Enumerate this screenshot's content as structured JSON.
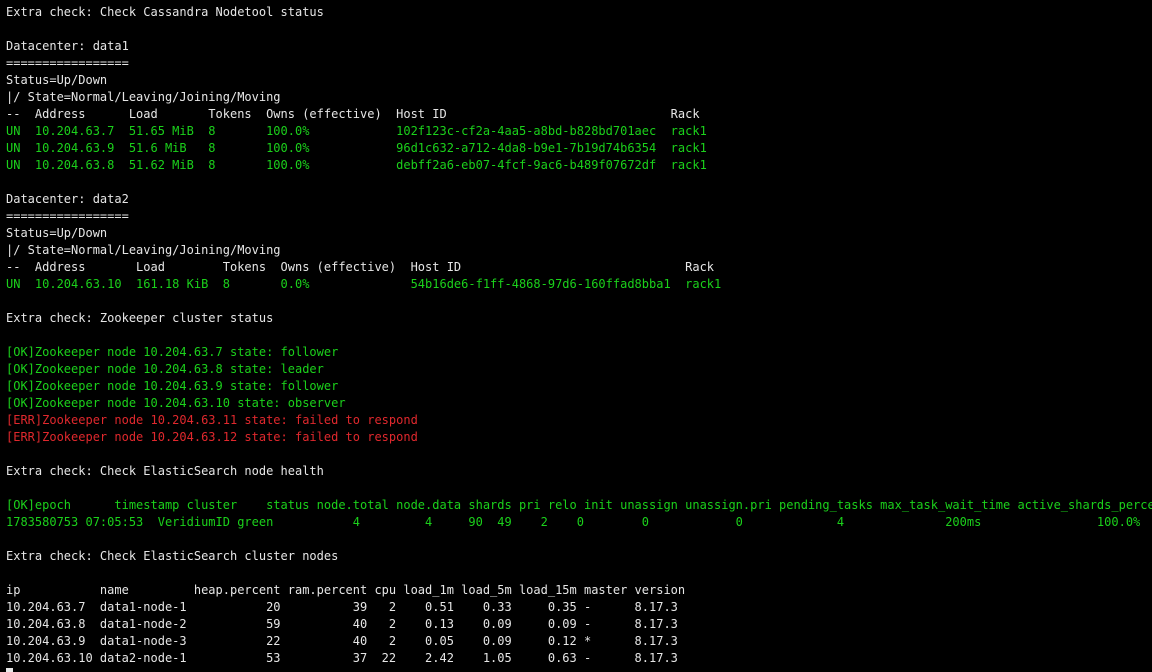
{
  "colors": {
    "background": "#000000",
    "text": "#e6e6e6",
    "ok_green": "#1bd11b",
    "error_red": "#e0282d"
  },
  "lines": [
    {
      "text": "Extra check: Check Cassandra Nodetool status",
      "color": "white"
    },
    {
      "text": "",
      "color": "white"
    },
    {
      "text": "Datacenter: data1",
      "color": "white"
    },
    {
      "text": "=================",
      "color": "white"
    },
    {
      "text": "Status=Up/Down",
      "color": "white"
    },
    {
      "text": "|/ State=Normal/Leaving/Joining/Moving",
      "color": "white"
    },
    {
      "text": "--  Address      Load       Tokens  Owns (effective)  Host ID                               Rack",
      "color": "white"
    },
    {
      "text": "UN  10.204.63.7  51.65 MiB  8       100.0%            102f123c-cf2a-4aa5-a8bd-b828bd701aec  rack1",
      "color": "green"
    },
    {
      "text": "UN  10.204.63.9  51.6 MiB   8       100.0%            96d1c632-a712-4da8-b9e1-7b19d74b6354  rack1",
      "color": "green"
    },
    {
      "text": "UN  10.204.63.8  51.62 MiB  8       100.0%            debff2a6-eb07-4fcf-9ac6-b489f07672df  rack1",
      "color": "green"
    },
    {
      "text": "",
      "color": "white"
    },
    {
      "text": "Datacenter: data2",
      "color": "white"
    },
    {
      "text": "=================",
      "color": "white"
    },
    {
      "text": "Status=Up/Down",
      "color": "white"
    },
    {
      "text": "|/ State=Normal/Leaving/Joining/Moving",
      "color": "white"
    },
    {
      "text": "--  Address       Load        Tokens  Owns (effective)  Host ID                               Rack",
      "color": "white"
    },
    {
      "text": "UN  10.204.63.10  161.18 KiB  8       0.0%              54b16de6-f1ff-4868-97d6-160ffad8bba1  rack1",
      "color": "green"
    },
    {
      "text": "",
      "color": "white"
    },
    {
      "text": "Extra check: Zookeeper cluster status",
      "color": "white"
    },
    {
      "text": "",
      "color": "white"
    },
    {
      "text": "[OK]Zookeeper node 10.204.63.7 state: follower",
      "color": "green"
    },
    {
      "text": "[OK]Zookeeper node 10.204.63.8 state: leader",
      "color": "green"
    },
    {
      "text": "[OK]Zookeeper node 10.204.63.9 state: follower",
      "color": "green"
    },
    {
      "text": "[OK]Zookeeper node 10.204.63.10 state: observer",
      "color": "green"
    },
    {
      "text": "[ERR]Zookeeper node 10.204.63.11 state: failed to respond",
      "color": "red"
    },
    {
      "text": "[ERR]Zookeeper node 10.204.63.12 state: failed to respond",
      "color": "red"
    },
    {
      "text": "",
      "color": "white"
    },
    {
      "text": "Extra check: Check ElasticSearch node health",
      "color": "white"
    },
    {
      "text": "",
      "color": "white"
    },
    {
      "text": "[OK]epoch      timestamp cluster    status node.total node.data shards pri relo init unassign unassign.pri pending_tasks max_task_wait_time active_shards_percent",
      "color": "green"
    },
    {
      "text": "1783580753 07:05:53  VeridiumID green           4         4     90  49    2    0        0            0             4              200ms                100.0%",
      "color": "green"
    },
    {
      "text": "",
      "color": "white"
    },
    {
      "text": "Extra check: Check ElasticSearch cluster nodes",
      "color": "white"
    },
    {
      "text": "",
      "color": "white"
    },
    {
      "text": "ip           name         heap.percent ram.percent cpu load_1m load_5m load_15m master version",
      "color": "white"
    },
    {
      "text": "10.204.63.7  data1-node-1           20          39   2    0.51    0.33     0.35 -      8.17.3",
      "color": "white"
    },
    {
      "text": "10.204.63.8  data1-node-2           59          40   2    0.13    0.09     0.09 -      8.17.3",
      "color": "white"
    },
    {
      "text": "10.204.63.9  data1-node-3           22          40   2    0.05    0.09     0.12 *      8.17.3",
      "color": "white"
    },
    {
      "text": "10.204.63.10 data2-node-1           53          37  22    2.42    1.05     0.63 -      8.17.3",
      "color": "white"
    },
    {
      "text": "",
      "color": "white",
      "cursor": true
    }
  ]
}
